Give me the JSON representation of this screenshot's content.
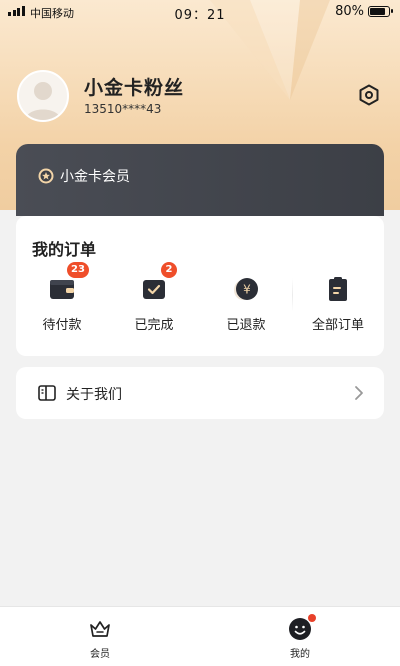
{
  "status_bar": {
    "carrier": "中国移动",
    "time": "09：21",
    "battery": "80%"
  },
  "profile": {
    "name": "小金卡粉丝",
    "phone": "13510****43",
    "avatar_icon": "user-avatar-icon",
    "settings_icon": "hexagon-settings-icon"
  },
  "vip": {
    "label": "小金卡会员",
    "icon": "star-badge-icon"
  },
  "orders": {
    "title": "我的订单",
    "items": [
      {
        "label": "待付款",
        "badge": "23",
        "icon": "wallet-icon"
      },
      {
        "label": "已完成",
        "badge": "2",
        "icon": "check-wallet-icon"
      },
      {
        "label": "已退款",
        "badge": "",
        "icon": "yuan-refund-icon"
      },
      {
        "label": "全部订单",
        "badge": "",
        "icon": "clipboard-icon"
      }
    ]
  },
  "about": {
    "label": "关于我们",
    "icon": "book-icon"
  },
  "tabbar": {
    "tabs": [
      {
        "label": "会员",
        "icon": "crown-icon"
      },
      {
        "label": "我的",
        "icon": "smiley-icon"
      }
    ]
  },
  "colors": {
    "header_gradient_top": "#fbe9d0",
    "header_gradient_bottom": "#f0cda0",
    "vip_card": "#45484f",
    "badge": "#ef4e2a",
    "page_bg": "#f2f2f2"
  }
}
